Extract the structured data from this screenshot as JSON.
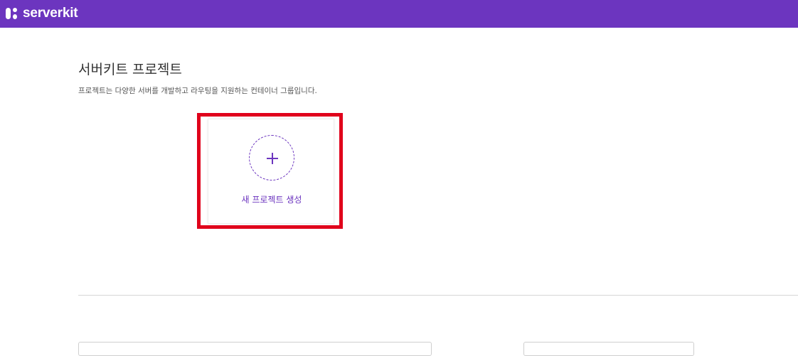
{
  "app": {
    "brand_name": "serverkit",
    "brand_color": "#6c35bf"
  },
  "page": {
    "title": "서버키트 프로젝트",
    "description": "프로젝트는 다양한 서버를 개발하고 라우팅을 지원하는 컨테이너 그룹입니다."
  },
  "new_project_card": {
    "label": "새 프로젝트 생성",
    "icon": "plus-icon",
    "highlight_color": "#e0001b"
  }
}
